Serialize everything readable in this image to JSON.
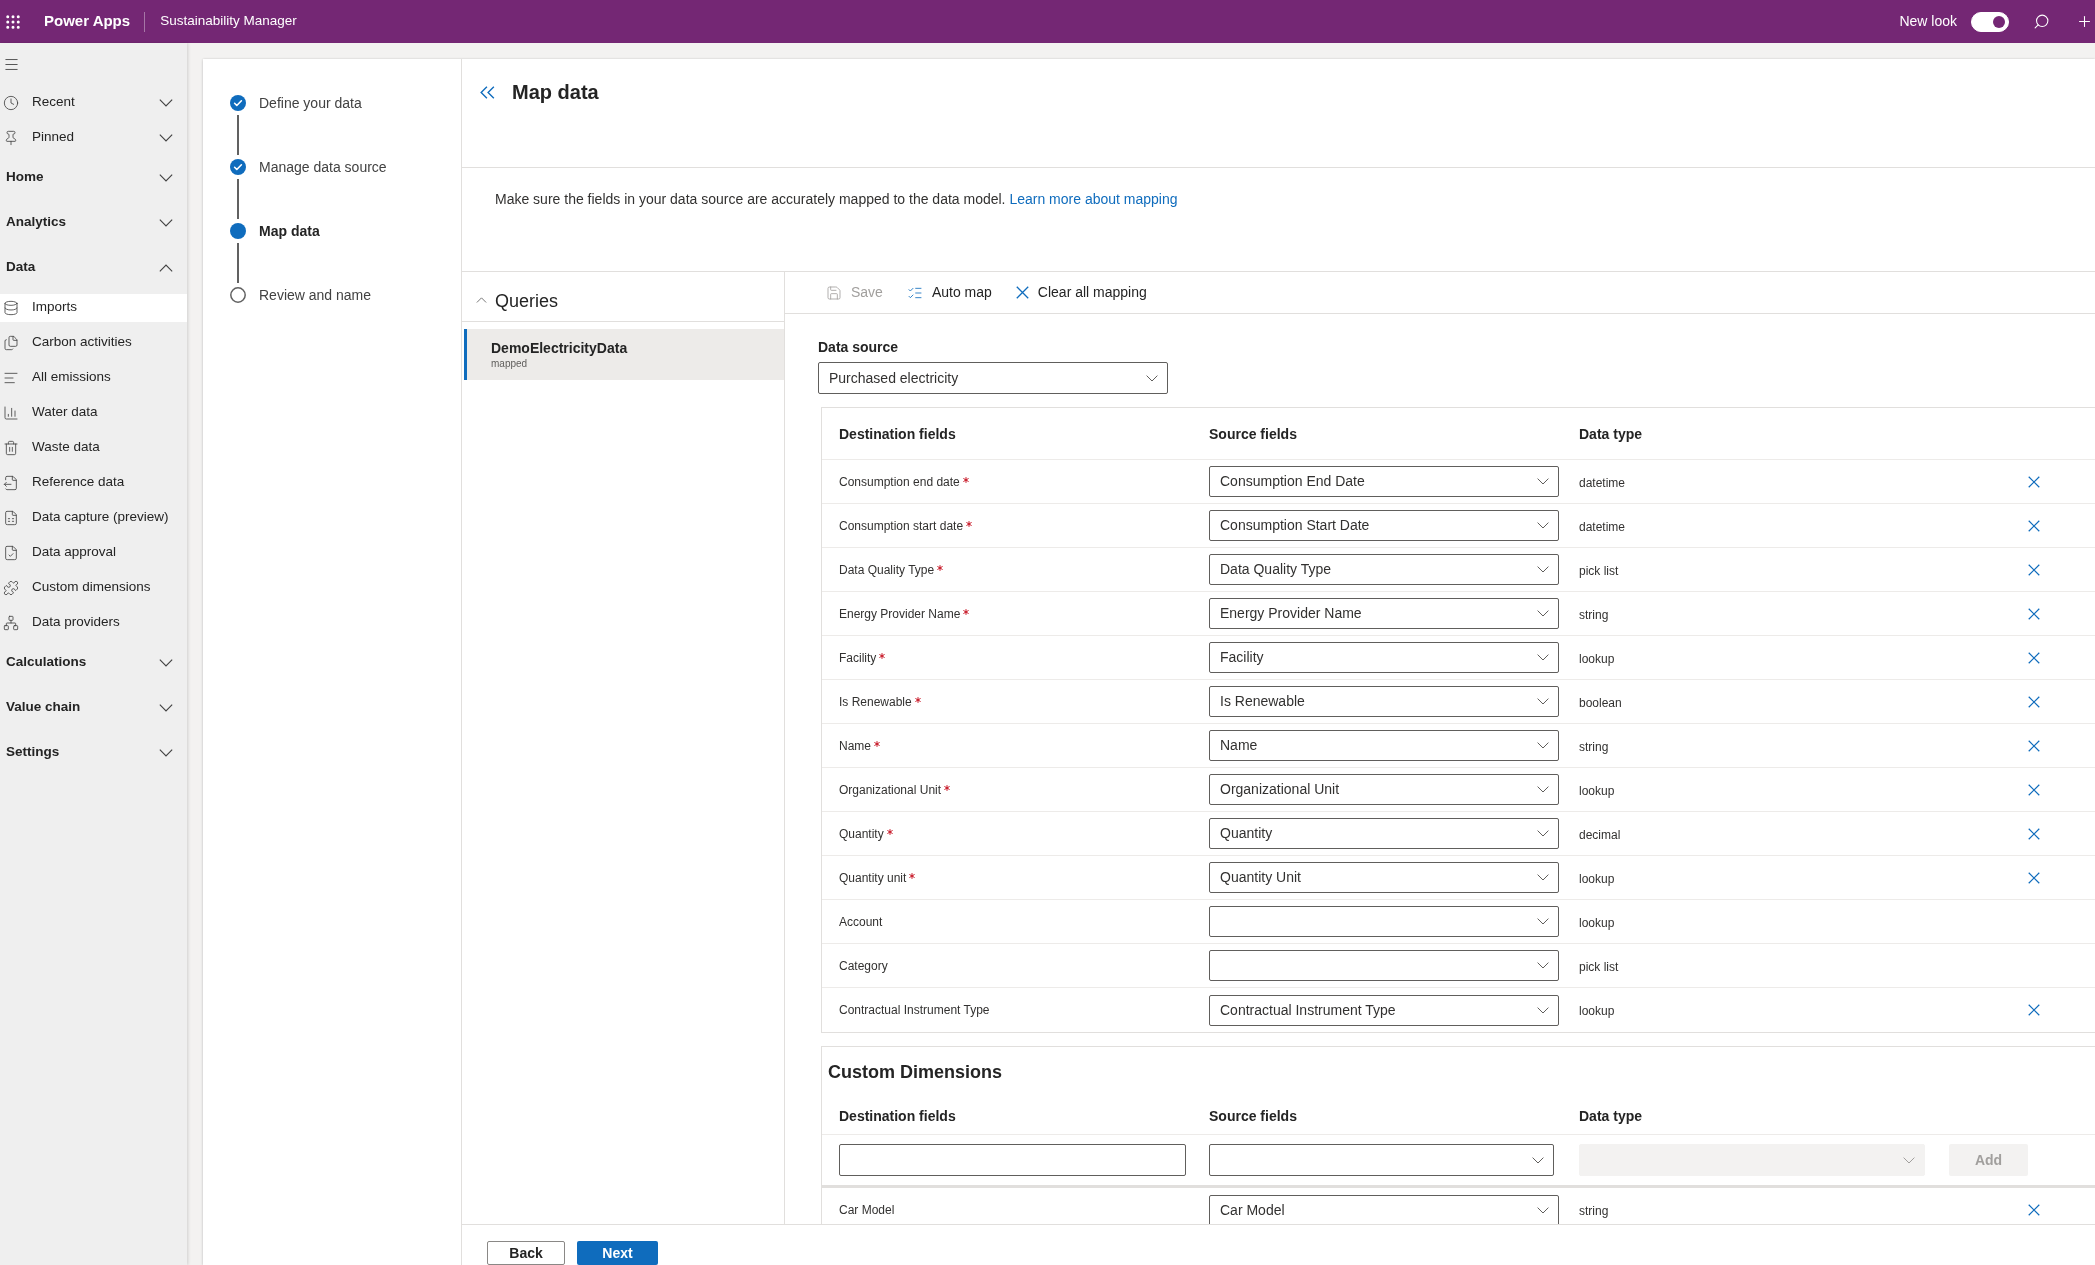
{
  "top_bar": {
    "app_name": "Power Apps",
    "environment": "Sustainability Manager",
    "new_look": {
      "label": "New look",
      "on": true
    }
  },
  "sidebar": {
    "items": [
      {
        "kind": "recent",
        "label": "Recent",
        "expanded": false
      },
      {
        "kind": "pinned",
        "label": "Pinned",
        "expanded": false
      },
      {
        "kind": "group",
        "label": "Home",
        "expanded": false
      },
      {
        "kind": "group",
        "label": "Analytics",
        "expanded": false
      },
      {
        "kind": "group",
        "label": "Data",
        "expanded": true,
        "children": [
          {
            "label": "Imports",
            "selected": true
          },
          {
            "label": "Carbon activities",
            "selected": false
          },
          {
            "label": "All emissions",
            "selected": false
          },
          {
            "label": "Water data",
            "selected": false
          },
          {
            "label": "Waste data",
            "selected": false
          },
          {
            "label": "Reference data",
            "selected": false
          },
          {
            "label": "Data capture (preview)",
            "selected": false
          },
          {
            "label": "Data approval",
            "selected": false
          },
          {
            "label": "Custom dimensions",
            "selected": false
          },
          {
            "label": "Data providers",
            "selected": false
          }
        ]
      },
      {
        "kind": "group",
        "label": "Calculations",
        "expanded": false
      },
      {
        "kind": "group",
        "label": "Value chain",
        "expanded": false
      },
      {
        "kind": "group",
        "label": "Settings",
        "expanded": false
      }
    ]
  },
  "steps": [
    {
      "label": "Define your data",
      "completed": true,
      "selected": false
    },
    {
      "label": "Manage data source",
      "completed": true,
      "selected": false
    },
    {
      "label": "Map data",
      "completed": false,
      "selected": true
    },
    {
      "label": "Review and name",
      "completed": false,
      "selected": false
    }
  ],
  "header": {
    "title": "Map data"
  },
  "description": {
    "text": "Make sure the fields in your data source are accurately mapped to the data model.",
    "link": "Learn more about mapping"
  },
  "queries": {
    "title": "Queries",
    "expanded": true,
    "items": [
      {
        "name": "DemoElectricityData",
        "status": "mapped",
        "selected": true
      }
    ]
  },
  "toolbar": [
    {
      "label": "Save",
      "disabled": true
    },
    {
      "label": "Auto map",
      "disabled": false
    },
    {
      "label": "Clear all mapping",
      "disabled": false
    }
  ],
  "data_source": {
    "label": "Data source",
    "value": "Purchased electricity"
  },
  "mapping": {
    "columns": [
      "Destination fields",
      "Source fields",
      "Data type"
    ],
    "rows": [
      {
        "destination": "Consumption end date",
        "required": true,
        "source": "Consumption End Date",
        "data_type": "datetime"
      },
      {
        "destination": "Consumption start date",
        "required": true,
        "source": "Consumption Start Date",
        "data_type": "datetime"
      },
      {
        "destination": "Data Quality Type",
        "required": true,
        "source": "Data Quality Type",
        "data_type": "pick list"
      },
      {
        "destination": "Energy Provider Name",
        "required": true,
        "source": "Energy Provider Name",
        "data_type": "string"
      },
      {
        "destination": "Facility",
        "required": true,
        "source": "Facility",
        "data_type": "lookup"
      },
      {
        "destination": "Is Renewable",
        "required": true,
        "source": "Is Renewable",
        "data_type": "boolean"
      },
      {
        "destination": "Name",
        "required": true,
        "source": "Name",
        "data_type": "string"
      },
      {
        "destination": "Organizational Unit",
        "required": true,
        "source": "Organizational Unit",
        "data_type": "lookup"
      },
      {
        "destination": "Quantity",
        "required": true,
        "source": "Quantity",
        "data_type": "decimal"
      },
      {
        "destination": "Quantity unit",
        "required": true,
        "source": "Quantity Unit",
        "data_type": "lookup"
      },
      {
        "destination": "Account",
        "required": false,
        "data_type": "lookup"
      },
      {
        "destination": "Category",
        "required": false,
        "data_type": "pick list"
      },
      {
        "destination": "Contractual Instrument Type",
        "required": false,
        "source": "Contractual Instrument Type",
        "data_type": "lookup"
      }
    ]
  },
  "custom_dimensions": {
    "title": "Custom Dimensions",
    "columns": [
      "Destination fields",
      "Source fields",
      "Data type"
    ],
    "new_row": {
      "data_type_disabled": true,
      "add": {
        "label": "Add",
        "disabled": true
      }
    },
    "rows": [
      {
        "destination": "Car Model",
        "source": "Car Model",
        "data_type": "string"
      }
    ]
  },
  "footer": {
    "buttons": [
      {
        "label": "Back",
        "kind": "secondary"
      },
      {
        "label": "Next",
        "kind": "primary"
      }
    ]
  }
}
